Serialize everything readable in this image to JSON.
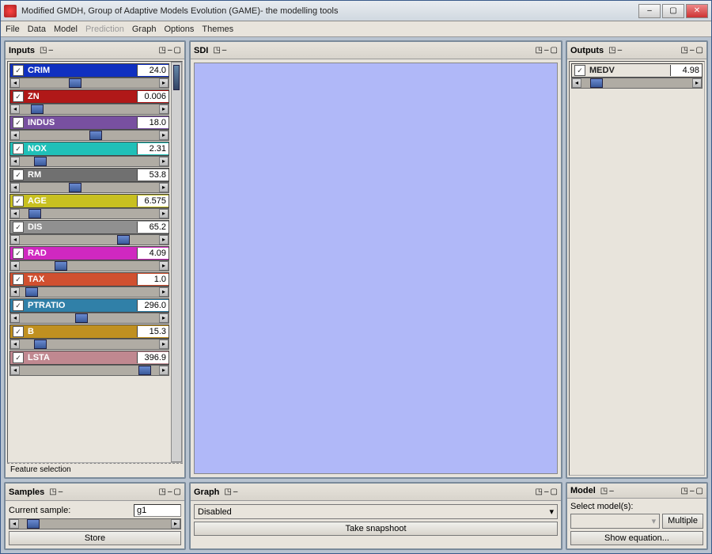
{
  "window": {
    "title": "Modified GMDH, Group of Adaptive Models Evolution (GAME)- the modelling tools"
  },
  "menu": [
    "File",
    "Data",
    "Model",
    "Prediction",
    "Graph",
    "Options",
    "Themes"
  ],
  "menu_disabled_index": 3,
  "panels": {
    "inputs": "Inputs",
    "sdi": "SDI",
    "outputs": "Outputs",
    "samples": "Samples",
    "graph": "Graph",
    "model": "Model"
  },
  "inputs": [
    {
      "name": "CRIM",
      "value": "24.0",
      "color": "#1030c0",
      "thumb": 35
    },
    {
      "name": "ZN",
      "value": "0.006",
      "color": "#b01818",
      "thumb": 8
    },
    {
      "name": "INDUS",
      "value": "18.0",
      "color": "#7850a0",
      "thumb": 50
    },
    {
      "name": "NOX",
      "value": "2.31",
      "color": "#20c0b8",
      "thumb": 10
    },
    {
      "name": "RM",
      "value": "53.8",
      "color": "#707070",
      "thumb": 35
    },
    {
      "name": "AGE",
      "value": "6.575",
      "color": "#c8c020",
      "thumb": 6
    },
    {
      "name": "DIS",
      "value": "65.2",
      "color": "#909090",
      "thumb": 70
    },
    {
      "name": "RAD",
      "value": "4.09",
      "color": "#d028c0",
      "thumb": 25
    },
    {
      "name": "TAX",
      "value": "1.0",
      "color": "#d05030",
      "thumb": 4
    },
    {
      "name": "PTRATIO",
      "value": "296.0",
      "color": "#3080a8",
      "thumb": 40
    },
    {
      "name": "B",
      "value": "15.3",
      "color": "#c09020",
      "thumb": 10
    },
    {
      "name": "LSTA",
      "value": "396.9",
      "color": "#c08890",
      "thumb": 85
    }
  ],
  "feature_selection": "Feature selection",
  "outputs": [
    {
      "name": "MEDV",
      "value": "4.98",
      "thumb": 8
    }
  ],
  "samples": {
    "label": "Current sample:",
    "value": "g1",
    "store": "Store"
  },
  "graph": {
    "state": "Disabled",
    "snapshot": "Take snapshoot"
  },
  "model": {
    "select_label": "Select model(s):",
    "multiple": "Multiple",
    "show_eq": "Show equation..."
  }
}
